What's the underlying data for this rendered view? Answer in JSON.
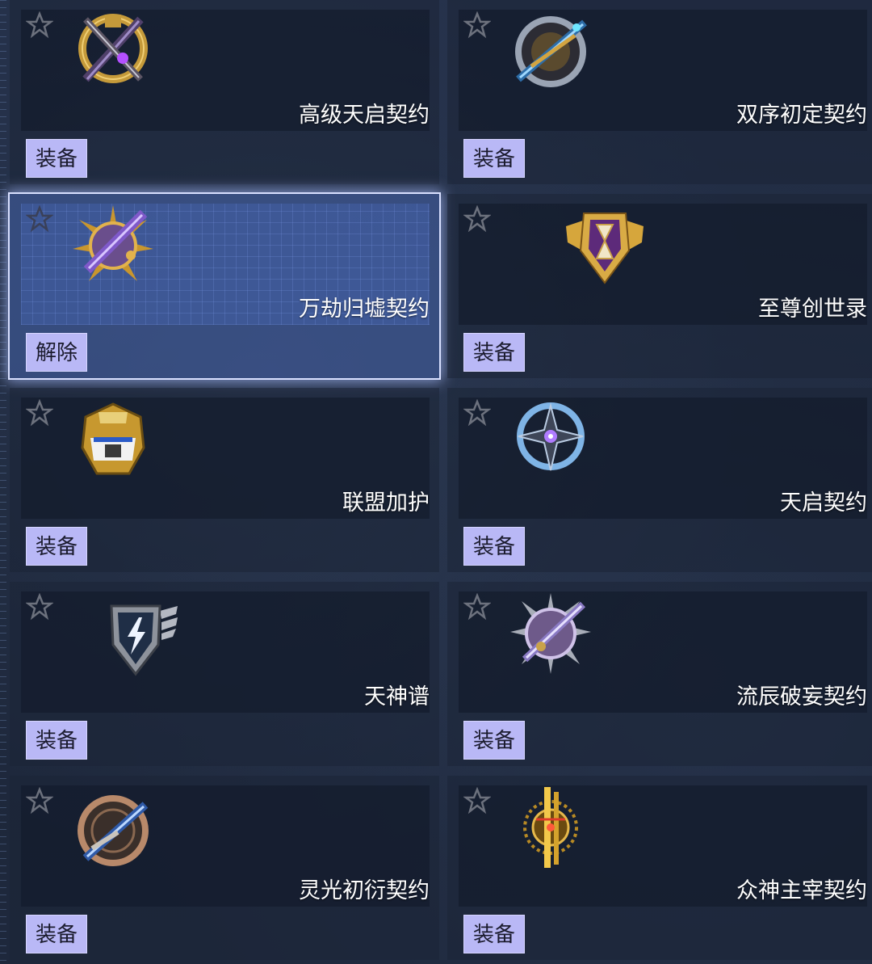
{
  "colors": {
    "button_bg": "#b9b8f6",
    "selected_glow": "#d9e0ff",
    "panel_bg": "#1c2436"
  },
  "items": [
    {
      "name": "高级天启契约",
      "button": "装备",
      "selected": false,
      "icon": "crossed-swords-gold-emblem-icon"
    },
    {
      "name": "双序初定契约",
      "button": "装备",
      "selected": false,
      "icon": "blue-blade-ring-emblem-icon"
    },
    {
      "name": "万劫归墟契约",
      "button": "解除",
      "selected": true,
      "icon": "violet-spiked-blade-emblem-icon"
    },
    {
      "name": "至尊创世录",
      "button": "装备",
      "selected": false,
      "icon": "golden-hourglass-shield-icon"
    },
    {
      "name": "联盟加护",
      "button": "装备",
      "selected": false,
      "icon": "golden-helmet-icon"
    },
    {
      "name": "天启契约",
      "button": "装备",
      "selected": false,
      "icon": "blue-star-orb-emblem-icon"
    },
    {
      "name": "天神谱",
      "button": "装备",
      "selected": false,
      "icon": "lightning-winged-shield-icon"
    },
    {
      "name": "流辰破妄契约",
      "button": "装备",
      "selected": false,
      "icon": "lavender-blade-star-emblem-icon"
    },
    {
      "name": "灵光初衍契约",
      "button": "装备",
      "selected": false,
      "icon": "bronze-blade-ring-emblem-icon"
    },
    {
      "name": "众神主宰契约",
      "button": "装备",
      "selected": false,
      "icon": "golden-pillar-sigil-icon"
    }
  ]
}
